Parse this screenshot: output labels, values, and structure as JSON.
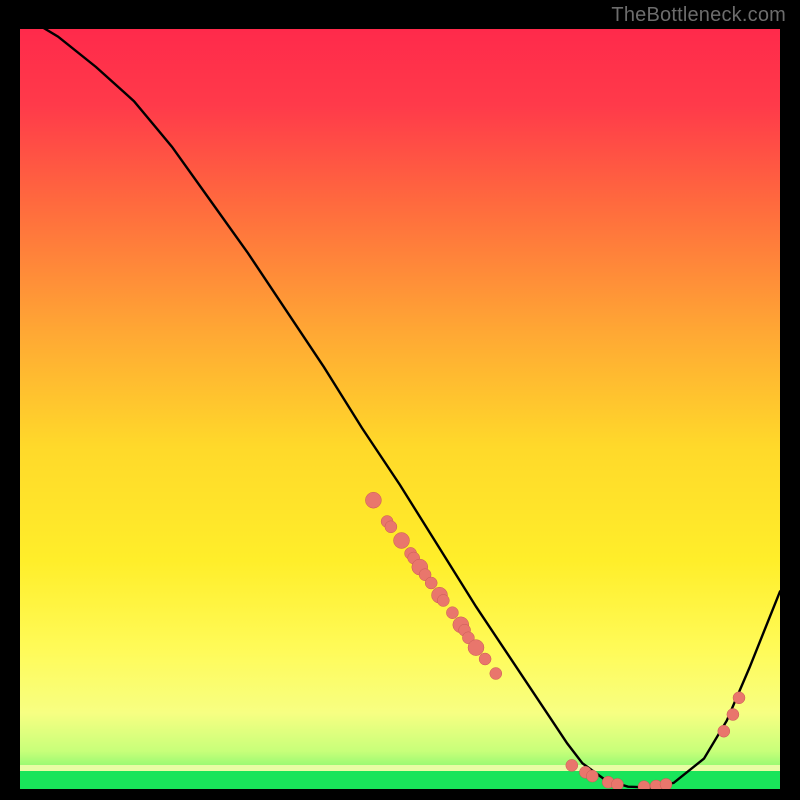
{
  "watermark": "TheBottleneck.com",
  "colors": {
    "gradient_stops": [
      {
        "offset": 0.0,
        "color": "#ff2a4b"
      },
      {
        "offset": 0.1,
        "color": "#ff3a4a"
      },
      {
        "offset": 0.23,
        "color": "#ff6a3e"
      },
      {
        "offset": 0.4,
        "color": "#ffa834"
      },
      {
        "offset": 0.55,
        "color": "#ffd92a"
      },
      {
        "offset": 0.7,
        "color": "#ffee2a"
      },
      {
        "offset": 0.82,
        "color": "#fffb5a"
      },
      {
        "offset": 0.9,
        "color": "#f7ff82"
      },
      {
        "offset": 0.95,
        "color": "#c8ff7a"
      },
      {
        "offset": 0.975,
        "color": "#8cf870"
      },
      {
        "offset": 1.0,
        "color": "#19e45a"
      }
    ],
    "curve": "#000000",
    "marker_fill": "#e9766c",
    "marker_stroke": "#c95a55",
    "green_strip": "#19e45a"
  },
  "chart_data": {
    "type": "line",
    "series": [
      {
        "name": "bottleneck-curve",
        "x": [
          0,
          5,
          10,
          15,
          20,
          25,
          30,
          35,
          40,
          45,
          50,
          55,
          60,
          65,
          70,
          72,
          74,
          77,
          80,
          83,
          86,
          90,
          93,
          96,
          100
        ],
        "y": [
          102,
          99,
          95,
          90.5,
          84.5,
          77.5,
          70.5,
          63,
          55.5,
          47.5,
          40,
          32,
          24,
          16.5,
          9,
          6,
          3.4,
          1.2,
          0.3,
          0.2,
          0.8,
          4,
          9,
          16,
          26
        ]
      }
    ],
    "markers": [
      {
        "group": "upper-cluster",
        "points": [
          {
            "x": 46.5,
            "y": 38
          },
          {
            "x": 48.3,
            "y": 35.2
          },
          {
            "x": 48.8,
            "y": 34.5
          },
          {
            "x": 50.2,
            "y": 32.7
          },
          {
            "x": 51.4,
            "y": 31
          },
          {
            "x": 51.8,
            "y": 30.4
          },
          {
            "x": 52.6,
            "y": 29.2
          },
          {
            "x": 53.3,
            "y": 28.2
          },
          {
            "x": 54.1,
            "y": 27.1
          },
          {
            "x": 55.2,
            "y": 25.5
          },
          {
            "x": 55.7,
            "y": 24.8
          },
          {
            "x": 56.9,
            "y": 23.2
          },
          {
            "x": 58.0,
            "y": 21.6
          },
          {
            "x": 58.5,
            "y": 20.9
          },
          {
            "x": 59.0,
            "y": 19.9
          },
          {
            "x": 60.0,
            "y": 18.6
          },
          {
            "x": 61.2,
            "y": 17.1
          },
          {
            "x": 62.6,
            "y": 15.2
          }
        ]
      },
      {
        "group": "lower-valley",
        "points": [
          {
            "x": 72.6,
            "y": 3.1
          },
          {
            "x": 74.4,
            "y": 2.2
          },
          {
            "x": 75.3,
            "y": 1.7
          },
          {
            "x": 77.4,
            "y": 0.9
          },
          {
            "x": 78.6,
            "y": 0.6
          },
          {
            "x": 82.1,
            "y": 0.3
          },
          {
            "x": 83.7,
            "y": 0.4
          },
          {
            "x": 85.0,
            "y": 0.6
          }
        ]
      },
      {
        "group": "right-rise",
        "points": [
          {
            "x": 92.6,
            "y": 7.6
          },
          {
            "x": 93.8,
            "y": 9.8
          },
          {
            "x": 94.6,
            "y": 12
          }
        ]
      }
    ],
    "title": "",
    "xlabel": "",
    "ylabel": "",
    "xlim": [
      0,
      100
    ],
    "ylim": [
      0,
      100
    ]
  }
}
